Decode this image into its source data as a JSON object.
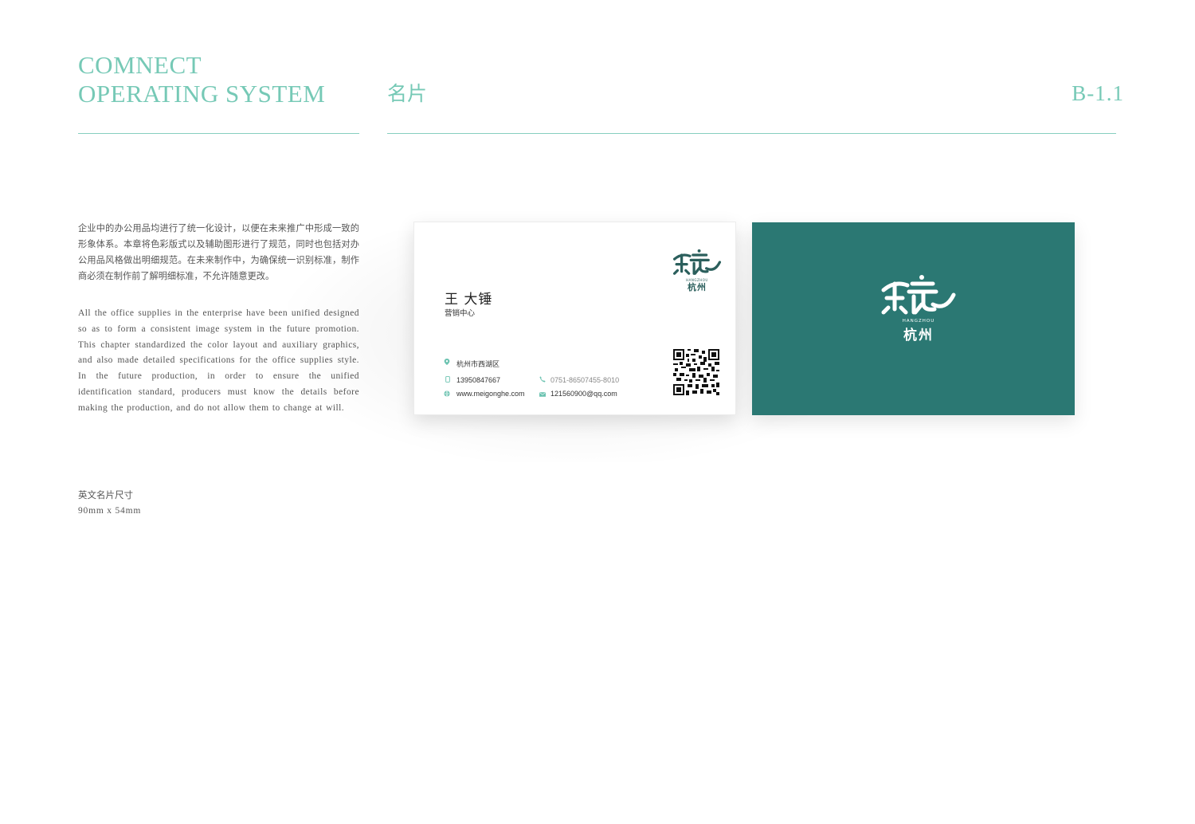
{
  "header": {
    "brand_line_1": "COMNECT",
    "brand_line_2": "OPERATING SYSTEM",
    "section_title": "名片",
    "page_code": "B-1.1"
  },
  "description": {
    "zh": "企业中的办公用品均进行了统一化设计，以便在未来推广中形成一致的形象体系。本章将色彩版式以及辅助图形进行了规范，同时也包括对办公用品风格做出明细规范。在未来制作中，为确保统一识别标准，制作商必须在制作前了解明细标准，不允许随意更改。",
    "en": "All the office supplies in the enterprise have been unified designed so as to form a consistent image system in the future promotion. This chapter standardized the color layout and auxiliary graphics, and also made detailed specifications for the office supplies style. In the future production, in order to ensure the unified identification standard, producers must know the details before making the production, and do not allow them to change at will."
  },
  "card_size": {
    "label": "英文名片尺寸",
    "value": "90mm x 54mm"
  },
  "card_front": {
    "logo_cn": "杭州",
    "logo_sub": "HANGZHOU",
    "name": "王 大锤",
    "department": "营销中心",
    "address": "杭州市西湖区",
    "mobile": "13950847667",
    "website": "www.meigonghe.com",
    "phone": "0751-86507455-8010",
    "email": "121560900@qq.com",
    "icons": [
      "location-icon",
      "mobile-icon",
      "globe-icon",
      "phone-icon",
      "mail-icon",
      "qr-code"
    ]
  },
  "card_back": {
    "logo_sub": "HANGZHOU",
    "logo_cn": "杭州"
  },
  "colors": {
    "accent": "#76c9b6",
    "card_back": "#2b7873",
    "logo_dark": "#2b5f5c"
  }
}
